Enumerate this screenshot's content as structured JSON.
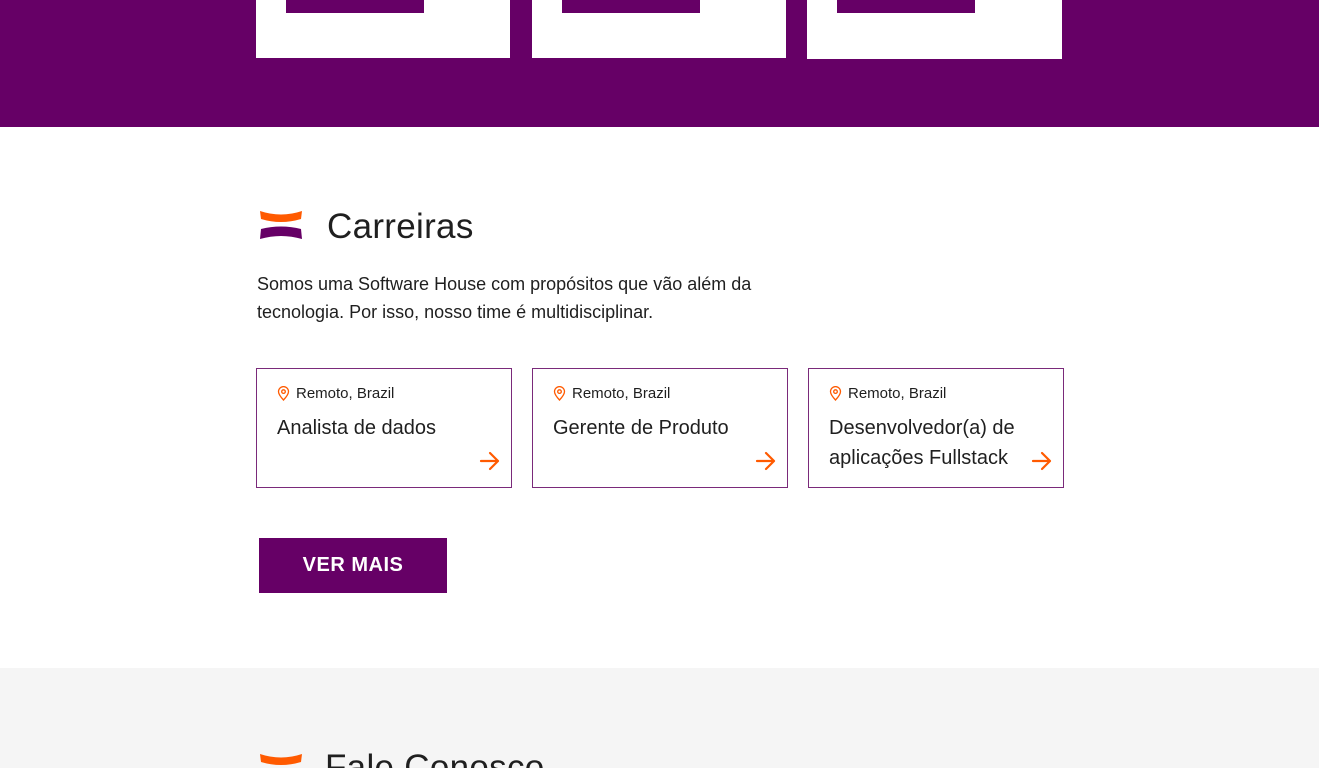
{
  "top_section": {
    "cards": [
      {
        "button_label": ""
      },
      {
        "button_label": ""
      },
      {
        "button_label": ""
      }
    ]
  },
  "careers": {
    "title": "Carreiras",
    "description": "Somos uma Software House com propósitos que vão além da tecnologia. Por isso, nosso time é multidisciplinar.",
    "jobs": [
      {
        "location": "Remoto, Brazil",
        "title": "Analista de dados"
      },
      {
        "location": "Remoto, Brazil",
        "title": "Gerente de Produto"
      },
      {
        "location": "Remoto, Brazil",
        "title": "Desenvolvedor(a) de aplicações Fullstack"
      }
    ],
    "more_button": "VER MAIS"
  },
  "contact": {
    "title": "Fale Conosco"
  },
  "colors": {
    "brand_purple": "#660066",
    "accent_orange": "#ff5a00",
    "card_border": "#7a2a7a",
    "contact_bg": "#f5f5f5"
  },
  "icons": {
    "section_logo": "brand-arcs-icon",
    "location": "map-pin-icon",
    "job_arrow": "arrow-right-icon"
  }
}
